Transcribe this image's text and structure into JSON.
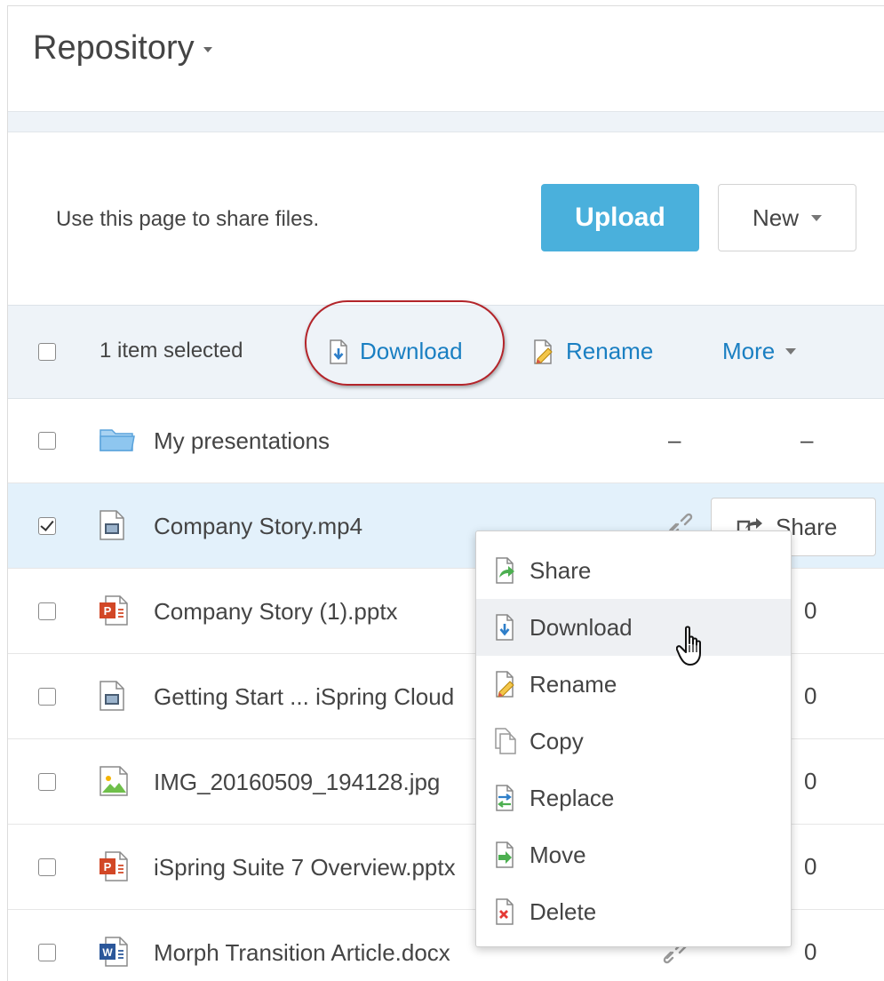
{
  "header": {
    "title": "Repository"
  },
  "intro": {
    "text": "Use this page to share files.",
    "upload_label": "Upload",
    "new_label": "New"
  },
  "toolbar": {
    "selection_text": "1 item selected",
    "download_label": "Download",
    "rename_label": "Rename",
    "more_label": "More"
  },
  "files": [
    {
      "name": "My presentations",
      "type": "folder",
      "col1": "–",
      "col2": "–",
      "checked": false
    },
    {
      "name": "Company Story.mp4",
      "type": "video",
      "share_label": "Share",
      "checked": true
    },
    {
      "name": "Company Story (1).pptx",
      "type": "pptx",
      "count": "0",
      "checked": false
    },
    {
      "name": "Getting Start ... iSpring Cloud",
      "type": "video",
      "count": "0",
      "checked": false
    },
    {
      "name": "IMG_20160509_194128.jpg",
      "type": "image",
      "count": "0",
      "checked": false
    },
    {
      "name": "iSpring Suite 7 Overview.pptx",
      "type": "pptx",
      "count": "0",
      "checked": false
    },
    {
      "name": "Morph Transition Article.docx",
      "type": "docx",
      "count": "0",
      "checked": false
    }
  ],
  "context_menu": {
    "items": [
      {
        "label": "Share",
        "icon": "share-icon"
      },
      {
        "label": "Download",
        "icon": "download-icon",
        "hovered": true
      },
      {
        "label": "Rename",
        "icon": "rename-icon"
      },
      {
        "label": "Copy",
        "icon": "copy-icon"
      },
      {
        "label": "Replace",
        "icon": "replace-icon"
      },
      {
        "label": "Move",
        "icon": "move-icon"
      },
      {
        "label": "Delete",
        "icon": "delete-icon"
      }
    ]
  },
  "colors": {
    "accent": "#4ab0dc",
    "link": "#1a7fc2",
    "highlight_oval": "#b3242a",
    "selected_row": "#e3f1fb"
  }
}
